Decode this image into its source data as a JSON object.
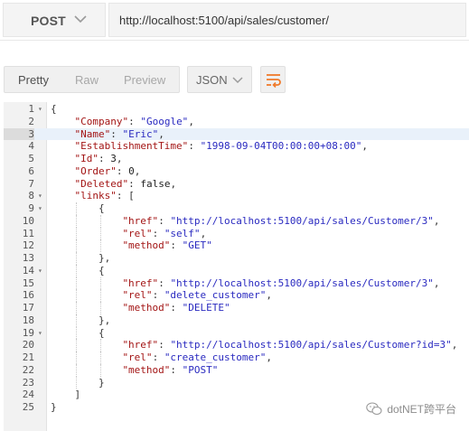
{
  "request": {
    "method": "POST",
    "url": "http://localhost:5100/api/sales/customer/"
  },
  "response_toolbar": {
    "tabs": [
      "Pretty",
      "Raw",
      "Preview"
    ],
    "active_tab": "Pretty",
    "format": "JSON",
    "wrap_icon": "wrap-lines-icon"
  },
  "viewer": {
    "highlight_line": 3,
    "foldable_lines": [
      1,
      8,
      9,
      14,
      19
    ],
    "lines": [
      [
        {
          "t": "p",
          "v": "{"
        }
      ],
      [
        {
          "t": "k",
          "v": "\"Company\""
        },
        {
          "t": "p",
          "v": ": "
        },
        {
          "t": "s",
          "v": "\"Google\""
        },
        {
          "t": "p",
          "v": ","
        }
      ],
      [
        {
          "t": "k",
          "v": "\"Name\""
        },
        {
          "t": "p",
          "v": ": "
        },
        {
          "t": "s",
          "v": "\"Eric\""
        },
        {
          "t": "p",
          "v": ","
        }
      ],
      [
        {
          "t": "k",
          "v": "\"EstablishmentTime\""
        },
        {
          "t": "p",
          "v": ": "
        },
        {
          "t": "s",
          "v": "\"1998-09-04T00:00:00+08:00\""
        },
        {
          "t": "p",
          "v": ","
        }
      ],
      [
        {
          "t": "k",
          "v": "\"Id\""
        },
        {
          "t": "p",
          "v": ": "
        },
        {
          "t": "n",
          "v": "3"
        },
        {
          "t": "p",
          "v": ","
        }
      ],
      [
        {
          "t": "k",
          "v": "\"Order\""
        },
        {
          "t": "p",
          "v": ": "
        },
        {
          "t": "n",
          "v": "0"
        },
        {
          "t": "p",
          "v": ","
        }
      ],
      [
        {
          "t": "k",
          "v": "\"Deleted\""
        },
        {
          "t": "p",
          "v": ": "
        },
        {
          "t": "n",
          "v": "false"
        },
        {
          "t": "p",
          "v": ","
        }
      ],
      [
        {
          "t": "k",
          "v": "\"links\""
        },
        {
          "t": "p",
          "v": ": ["
        }
      ],
      [
        {
          "t": "p",
          "v": "{"
        }
      ],
      [
        {
          "t": "k",
          "v": "\"href\""
        },
        {
          "t": "p",
          "v": ": "
        },
        {
          "t": "s",
          "v": "\"http://localhost:5100/api/sales/Customer/3\""
        },
        {
          "t": "p",
          "v": ","
        }
      ],
      [
        {
          "t": "k",
          "v": "\"rel\""
        },
        {
          "t": "p",
          "v": ": "
        },
        {
          "t": "s",
          "v": "\"self\""
        },
        {
          "t": "p",
          "v": ","
        }
      ],
      [
        {
          "t": "k",
          "v": "\"method\""
        },
        {
          "t": "p",
          "v": ": "
        },
        {
          "t": "s",
          "v": "\"GET\""
        }
      ],
      [
        {
          "t": "p",
          "v": "},"
        }
      ],
      [
        {
          "t": "p",
          "v": "{"
        }
      ],
      [
        {
          "t": "k",
          "v": "\"href\""
        },
        {
          "t": "p",
          "v": ": "
        },
        {
          "t": "s",
          "v": "\"http://localhost:5100/api/sales/Customer/3\""
        },
        {
          "t": "p",
          "v": ","
        }
      ],
      [
        {
          "t": "k",
          "v": "\"rel\""
        },
        {
          "t": "p",
          "v": ": "
        },
        {
          "t": "s",
          "v": "\"delete_customer\""
        },
        {
          "t": "p",
          "v": ","
        }
      ],
      [
        {
          "t": "k",
          "v": "\"method\""
        },
        {
          "t": "p",
          "v": ": "
        },
        {
          "t": "s",
          "v": "\"DELETE\""
        }
      ],
      [
        {
          "t": "p",
          "v": "},"
        }
      ],
      [
        {
          "t": "p",
          "v": "{"
        }
      ],
      [
        {
          "t": "k",
          "v": "\"href\""
        },
        {
          "t": "p",
          "v": ": "
        },
        {
          "t": "s",
          "v": "\"http://localhost:5100/api/sales/Customer?id=3\""
        },
        {
          "t": "p",
          "v": ","
        }
      ],
      [
        {
          "t": "k",
          "v": "\"rel\""
        },
        {
          "t": "p",
          "v": ": "
        },
        {
          "t": "s",
          "v": "\"create_customer\""
        },
        {
          "t": "p",
          "v": ","
        }
      ],
      [
        {
          "t": "k",
          "v": "\"method\""
        },
        {
          "t": "p",
          "v": ": "
        },
        {
          "t": "s",
          "v": "\"POST\""
        }
      ],
      [
        {
          "t": "p",
          "v": "}"
        }
      ],
      [
        {
          "t": "p",
          "v": "]"
        }
      ],
      [
        {
          "t": "p",
          "v": "}"
        }
      ]
    ]
  },
  "watermark": {
    "icon": "wechat-icon",
    "text": "dotNET跨平台"
  },
  "colors": {
    "json_key": "#a31515",
    "json_string": "#2a2ac0",
    "accent_orange": "#f07a2a"
  }
}
